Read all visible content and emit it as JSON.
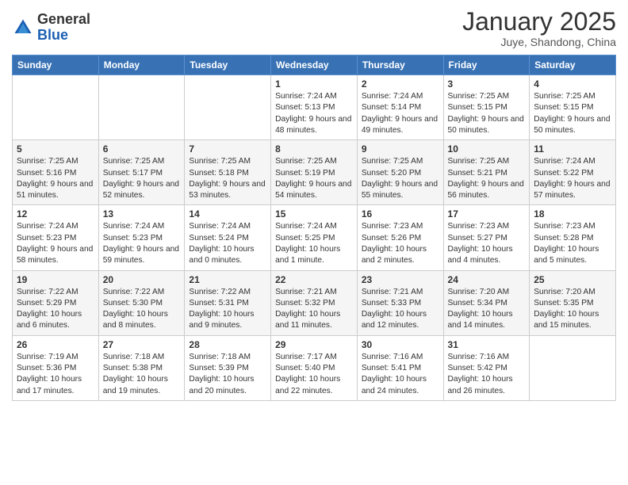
{
  "header": {
    "logo_general": "General",
    "logo_blue": "Blue",
    "month_year": "January 2025",
    "location": "Juye, Shandong, China"
  },
  "weekdays": [
    "Sunday",
    "Monday",
    "Tuesday",
    "Wednesday",
    "Thursday",
    "Friday",
    "Saturday"
  ],
  "weeks": [
    [
      {
        "day": "",
        "info": ""
      },
      {
        "day": "",
        "info": ""
      },
      {
        "day": "",
        "info": ""
      },
      {
        "day": "1",
        "info": "Sunrise: 7:24 AM\nSunset: 5:13 PM\nDaylight: 9 hours and 48 minutes."
      },
      {
        "day": "2",
        "info": "Sunrise: 7:24 AM\nSunset: 5:14 PM\nDaylight: 9 hours and 49 minutes."
      },
      {
        "day": "3",
        "info": "Sunrise: 7:25 AM\nSunset: 5:15 PM\nDaylight: 9 hours and 50 minutes."
      },
      {
        "day": "4",
        "info": "Sunrise: 7:25 AM\nSunset: 5:15 PM\nDaylight: 9 hours and 50 minutes."
      }
    ],
    [
      {
        "day": "5",
        "info": "Sunrise: 7:25 AM\nSunset: 5:16 PM\nDaylight: 9 hours and 51 minutes."
      },
      {
        "day": "6",
        "info": "Sunrise: 7:25 AM\nSunset: 5:17 PM\nDaylight: 9 hours and 52 minutes."
      },
      {
        "day": "7",
        "info": "Sunrise: 7:25 AM\nSunset: 5:18 PM\nDaylight: 9 hours and 53 minutes."
      },
      {
        "day": "8",
        "info": "Sunrise: 7:25 AM\nSunset: 5:19 PM\nDaylight: 9 hours and 54 minutes."
      },
      {
        "day": "9",
        "info": "Sunrise: 7:25 AM\nSunset: 5:20 PM\nDaylight: 9 hours and 55 minutes."
      },
      {
        "day": "10",
        "info": "Sunrise: 7:25 AM\nSunset: 5:21 PM\nDaylight: 9 hours and 56 minutes."
      },
      {
        "day": "11",
        "info": "Sunrise: 7:24 AM\nSunset: 5:22 PM\nDaylight: 9 hours and 57 minutes."
      }
    ],
    [
      {
        "day": "12",
        "info": "Sunrise: 7:24 AM\nSunset: 5:23 PM\nDaylight: 9 hours and 58 minutes."
      },
      {
        "day": "13",
        "info": "Sunrise: 7:24 AM\nSunset: 5:23 PM\nDaylight: 9 hours and 59 minutes."
      },
      {
        "day": "14",
        "info": "Sunrise: 7:24 AM\nSunset: 5:24 PM\nDaylight: 10 hours and 0 minutes."
      },
      {
        "day": "15",
        "info": "Sunrise: 7:24 AM\nSunset: 5:25 PM\nDaylight: 10 hours and 1 minute."
      },
      {
        "day": "16",
        "info": "Sunrise: 7:23 AM\nSunset: 5:26 PM\nDaylight: 10 hours and 2 minutes."
      },
      {
        "day": "17",
        "info": "Sunrise: 7:23 AM\nSunset: 5:27 PM\nDaylight: 10 hours and 4 minutes."
      },
      {
        "day": "18",
        "info": "Sunrise: 7:23 AM\nSunset: 5:28 PM\nDaylight: 10 hours and 5 minutes."
      }
    ],
    [
      {
        "day": "19",
        "info": "Sunrise: 7:22 AM\nSunset: 5:29 PM\nDaylight: 10 hours and 6 minutes."
      },
      {
        "day": "20",
        "info": "Sunrise: 7:22 AM\nSunset: 5:30 PM\nDaylight: 10 hours and 8 minutes."
      },
      {
        "day": "21",
        "info": "Sunrise: 7:22 AM\nSunset: 5:31 PM\nDaylight: 10 hours and 9 minutes."
      },
      {
        "day": "22",
        "info": "Sunrise: 7:21 AM\nSunset: 5:32 PM\nDaylight: 10 hours and 11 minutes."
      },
      {
        "day": "23",
        "info": "Sunrise: 7:21 AM\nSunset: 5:33 PM\nDaylight: 10 hours and 12 minutes."
      },
      {
        "day": "24",
        "info": "Sunrise: 7:20 AM\nSunset: 5:34 PM\nDaylight: 10 hours and 14 minutes."
      },
      {
        "day": "25",
        "info": "Sunrise: 7:20 AM\nSunset: 5:35 PM\nDaylight: 10 hours and 15 minutes."
      }
    ],
    [
      {
        "day": "26",
        "info": "Sunrise: 7:19 AM\nSunset: 5:36 PM\nDaylight: 10 hours and 17 minutes."
      },
      {
        "day": "27",
        "info": "Sunrise: 7:18 AM\nSunset: 5:38 PM\nDaylight: 10 hours and 19 minutes."
      },
      {
        "day": "28",
        "info": "Sunrise: 7:18 AM\nSunset: 5:39 PM\nDaylight: 10 hours and 20 minutes."
      },
      {
        "day": "29",
        "info": "Sunrise: 7:17 AM\nSunset: 5:40 PM\nDaylight: 10 hours and 22 minutes."
      },
      {
        "day": "30",
        "info": "Sunrise: 7:16 AM\nSunset: 5:41 PM\nDaylight: 10 hours and 24 minutes."
      },
      {
        "day": "31",
        "info": "Sunrise: 7:16 AM\nSunset: 5:42 PM\nDaylight: 10 hours and 26 minutes."
      },
      {
        "day": "",
        "info": ""
      }
    ]
  ]
}
